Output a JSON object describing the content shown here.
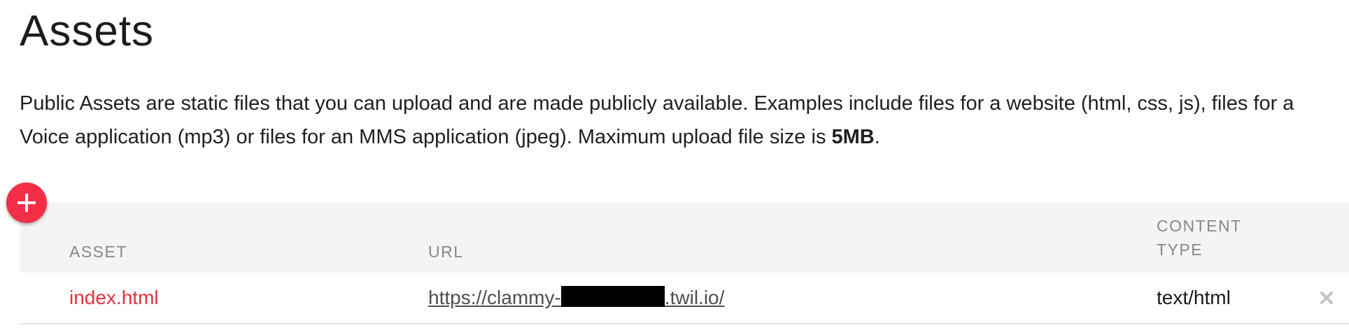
{
  "page": {
    "title": "Assets",
    "description": {
      "text": "Public Assets are static files that you can upload and are made publicly available. Examples include files for a website (html, css, js), files for a",
      "text_line2": "Voice application (mp3) or files for an MMS application (jpeg). Maximum upload file size is ",
      "max_size": "5MB",
      "suffix": "."
    }
  },
  "add_button": {
    "icon": "plus-icon",
    "color": "#f22f46"
  },
  "table": {
    "columns": [
      "ASSET",
      "URL",
      "CONTENT TYPE"
    ],
    "column_type_line1": "CONTENT",
    "column_type_line2": "TYPE",
    "rows": [
      {
        "asset": "index.html",
        "url_prefix": "https://clammy-",
        "url_suffix": ".twil.io/",
        "content_type": "text/html",
        "delete_icon": "close-icon"
      }
    ]
  },
  "colors": {
    "accent": "#f22f46",
    "asset_link": "#e0323d",
    "header_bg": "#f4f4f4",
    "header_text": "#888888"
  }
}
